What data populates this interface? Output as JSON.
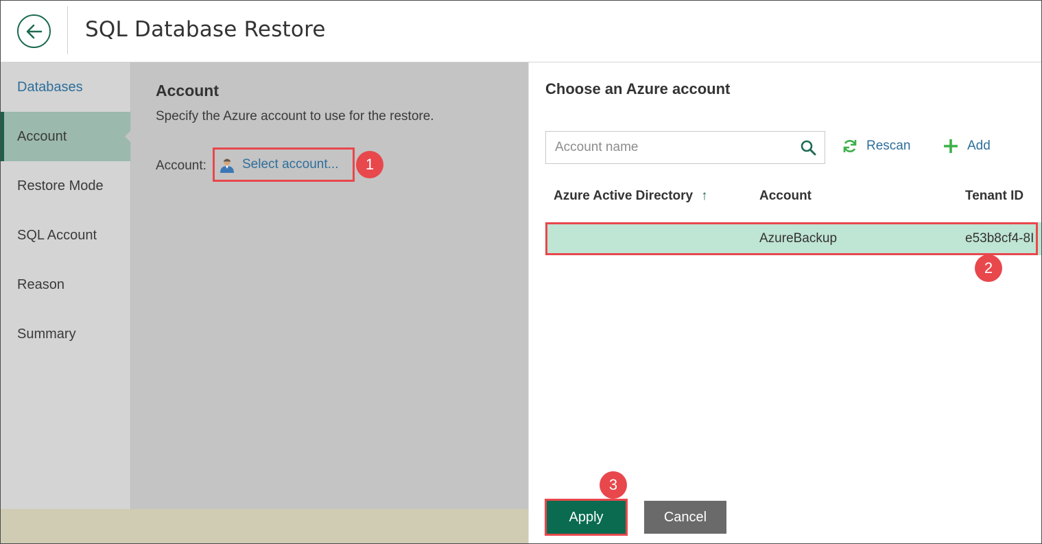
{
  "header": {
    "title": "SQL Database Restore"
  },
  "nav": {
    "items": [
      {
        "label": "Databases"
      },
      {
        "label": "Account"
      },
      {
        "label": "Restore Mode"
      },
      {
        "label": "SQL Account"
      },
      {
        "label": "Reason"
      },
      {
        "label": "Summary"
      }
    ],
    "active": "Account"
  },
  "main": {
    "heading": "Account",
    "description": "Specify the Azure account to use for the restore.",
    "account_label": "Account:",
    "select_account_label": "Select account..."
  },
  "callouts": {
    "one": "1",
    "two": "2",
    "three": "3"
  },
  "panel": {
    "title": "Choose an Azure account",
    "search": {
      "placeholder": "Account name",
      "value": ""
    },
    "rescan_label": "Rescan",
    "add_label": "Add",
    "columns": {
      "directory": "Azure Active Directory",
      "account": "Account",
      "tenant": "Tenant ID"
    },
    "sort_indicator": "↑",
    "rows": [
      {
        "directory": "",
        "account": "AzureBackup",
        "tenant": "e53b8cf4-8I"
      }
    ],
    "apply_label": "Apply",
    "cancel_label": "Cancel"
  },
  "colors": {
    "accent": "#0a6b51",
    "link": "#2d6e9a",
    "highlight": "#e8474c",
    "selected_row": "#bfe5d4"
  }
}
